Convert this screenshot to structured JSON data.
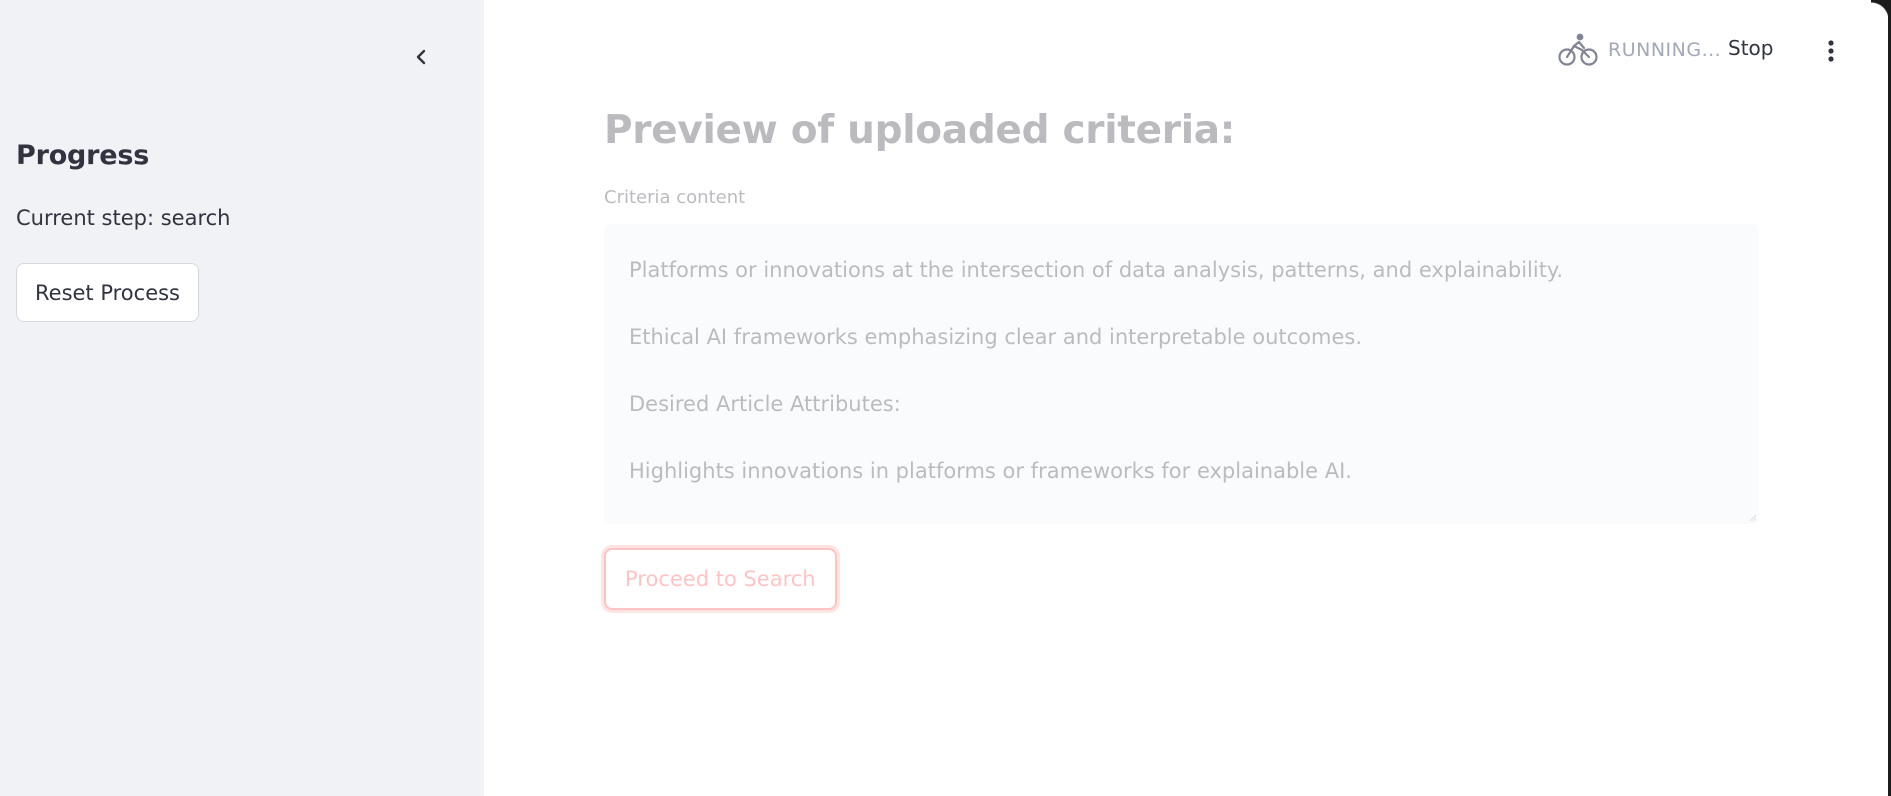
{
  "sidebar": {
    "title": "Progress",
    "current_step": "Current step: search",
    "reset_label": "Reset Process"
  },
  "header": {
    "status_text": "RUNNING...",
    "stop_label": "Stop",
    "status_icon": "bicycle-icon",
    "menu_icon": "kebab-menu-icon",
    "collapse_icon": "chevron-left-icon"
  },
  "main": {
    "title": "Preview of uploaded criteria:",
    "textarea_label": "Criteria content",
    "criteria_lines": [
      "Platforms or innovations at the intersection of data analysis, patterns, and explainability.",
      "Ethical AI frameworks emphasizing clear and interpretable outcomes.",
      "Desired Article Attributes:",
      "Highlights innovations in platforms or frameworks for explainable AI."
    ],
    "proceed_label": "Proceed to Search"
  },
  "colors": {
    "sidebar_bg": "#f0f2f6",
    "accent": "#ff4b4b",
    "text": "#31333f",
    "status_text": "#a3a8b8"
  }
}
